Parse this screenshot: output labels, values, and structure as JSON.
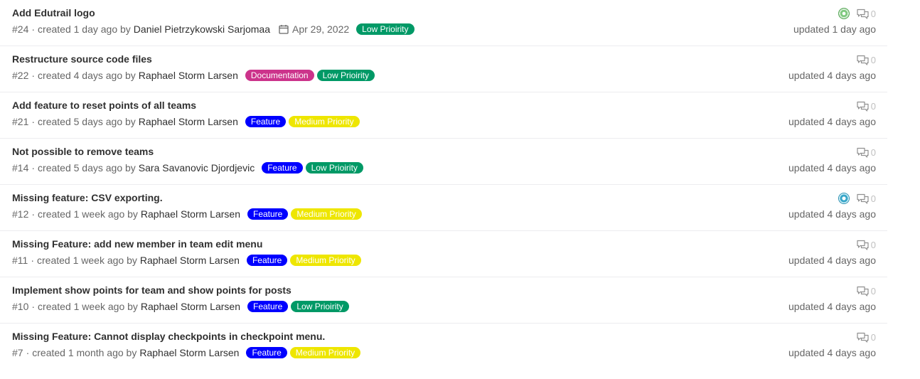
{
  "issues": [
    {
      "title": "Add Edutrail logo",
      "ref": "#24",
      "created_text": "created 1 day ago by",
      "author": "Daniel Pietrzykowski Sarjomaa",
      "milestone": "Apr 29, 2022",
      "labels": [
        {
          "text": "Low Prioirity",
          "bg": "#009966",
          "fg": "#ffffff"
        }
      ],
      "avatar": "green-identicon",
      "comments": "0",
      "updated": "updated 1 day ago"
    },
    {
      "title": "Restructure source code files",
      "ref": "#22",
      "created_text": "created 4 days ago by",
      "author": "Raphael Storm Larsen",
      "labels": [
        {
          "text": "Documentation",
          "bg": "#cc338b",
          "fg": "#ffffff"
        },
        {
          "text": "Low Prioirity",
          "bg": "#009966",
          "fg": "#ffffff"
        }
      ],
      "comments": "0",
      "updated": "updated 4 days ago"
    },
    {
      "title": "Add feature to reset points of all teams",
      "ref": "#21",
      "created_text": "created 5 days ago by",
      "author": "Raphael Storm Larsen",
      "labels": [
        {
          "text": "Feature",
          "bg": "#0000ff",
          "fg": "#ffffff"
        },
        {
          "text": "Medium Priority",
          "bg": "#eee600",
          "fg": "#ffffff"
        }
      ],
      "comments": "0",
      "updated": "updated 4 days ago"
    },
    {
      "title": "Not possible to remove teams",
      "ref": "#14",
      "created_text": "created 5 days ago by",
      "author": "Sara Savanovic Djordjevic",
      "labels": [
        {
          "text": "Feature",
          "bg": "#0000ff",
          "fg": "#ffffff"
        },
        {
          "text": "Low Prioirity",
          "bg": "#009966",
          "fg": "#ffffff"
        }
      ],
      "comments": "0",
      "updated": "updated 4 days ago"
    },
    {
      "title": "Missing feature: CSV exporting.",
      "ref": "#12",
      "created_text": "created 1 week ago by",
      "author": "Raphael Storm Larsen",
      "labels": [
        {
          "text": "Feature",
          "bg": "#0000ff",
          "fg": "#ffffff"
        },
        {
          "text": "Medium Priority",
          "bg": "#eee600",
          "fg": "#ffffff"
        }
      ],
      "avatar": "teal-identicon",
      "comments": "0",
      "updated": "updated 4 days ago"
    },
    {
      "title": "Missing Feature: add new member in team edit menu",
      "ref": "#11",
      "created_text": "created 1 week ago by",
      "author": "Raphael Storm Larsen",
      "labels": [
        {
          "text": "Feature",
          "bg": "#0000ff",
          "fg": "#ffffff"
        },
        {
          "text": "Medium Priority",
          "bg": "#eee600",
          "fg": "#ffffff"
        }
      ],
      "comments": "0",
      "updated": "updated 4 days ago"
    },
    {
      "title": "Implement show points for team and show points for posts",
      "ref": "#10",
      "created_text": "created 1 week ago by",
      "author": "Raphael Storm Larsen",
      "labels": [
        {
          "text": "Feature",
          "bg": "#0000ff",
          "fg": "#ffffff"
        },
        {
          "text": "Low Prioirity",
          "bg": "#009966",
          "fg": "#ffffff"
        }
      ],
      "comments": "0",
      "updated": "updated 4 days ago"
    },
    {
      "title": "Missing Feature: Cannot display checkpoints in checkpoint menu.",
      "ref": "#7",
      "created_text": "created 1 month ago by",
      "author": "Raphael Storm Larsen",
      "labels": [
        {
          "text": "Feature",
          "bg": "#0000ff",
          "fg": "#ffffff"
        },
        {
          "text": "Medium Priority",
          "bg": "#eee600",
          "fg": "#ffffff"
        }
      ],
      "comments": "0",
      "updated": "updated 4 days ago"
    }
  ],
  "icons": {
    "calendar": "calendar-icon",
    "comments": "comments-icon"
  }
}
